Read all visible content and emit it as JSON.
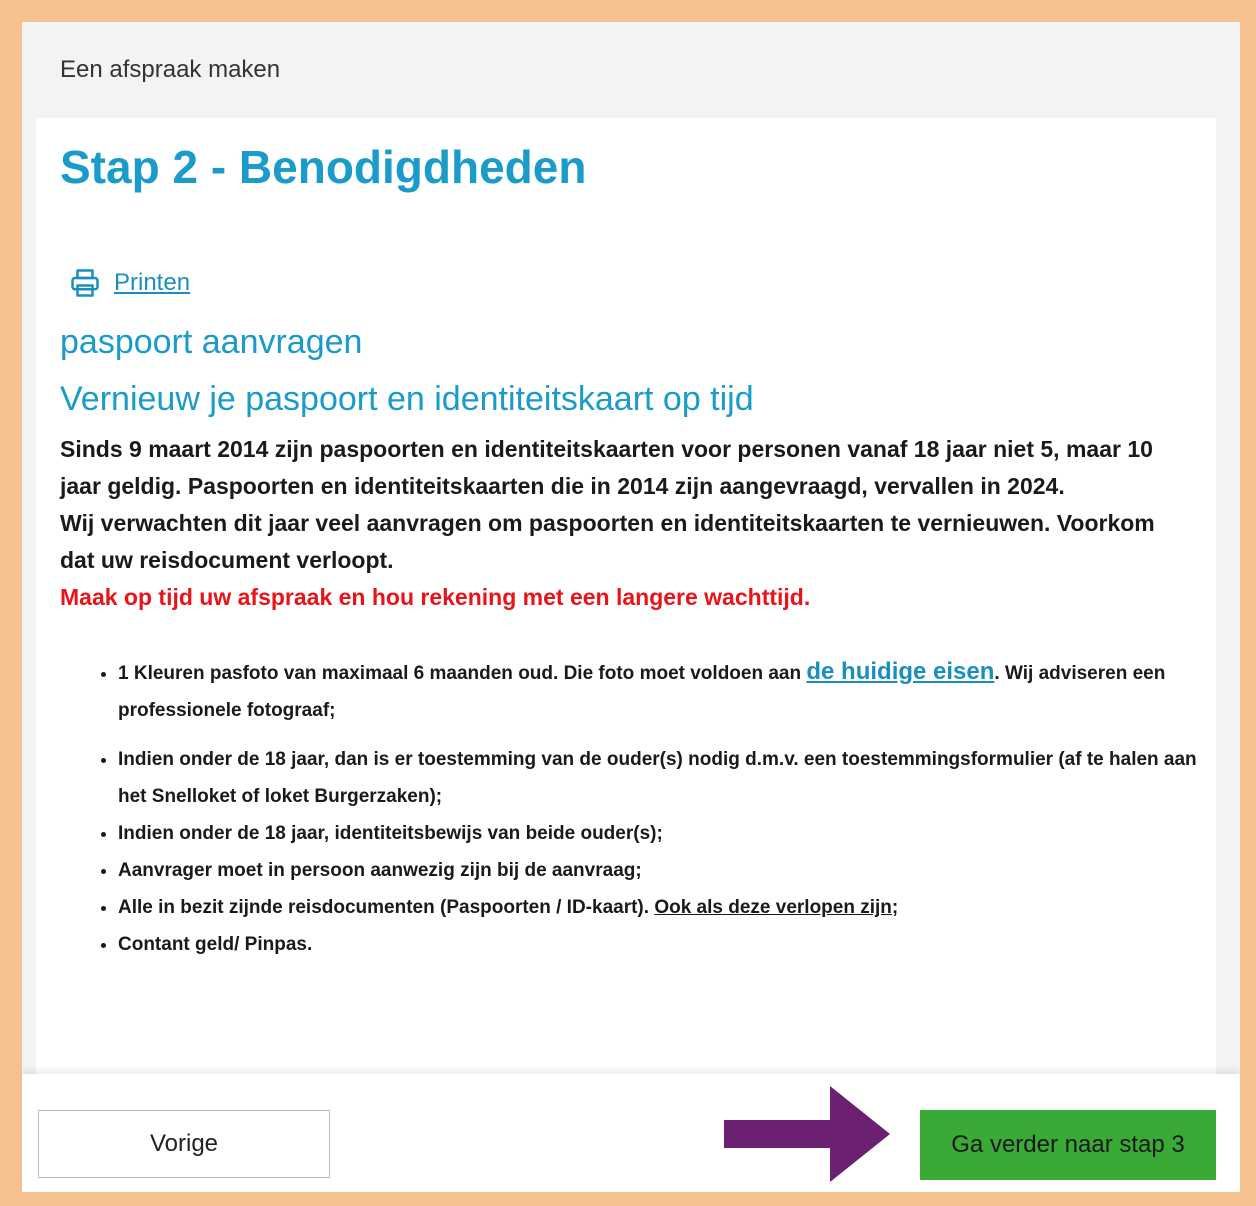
{
  "window": {
    "title": "Een afspraak maken"
  },
  "step": {
    "title": "Stap 2 - Benodigdheden"
  },
  "print": {
    "label": "Printen",
    "icon": "printer-icon"
  },
  "product": {
    "title": "paspoort aanvragen"
  },
  "notice": {
    "heading": "Vernieuw je paspoort en identiteitskaart op tijd",
    "paragraph1": "Sinds 9 maart 2014 zijn paspoorten en identiteitskaarten voor personen vanaf 18 jaar niet 5, maar 10 jaar geldig. Paspoorten en identiteitskaarten die in 2014 zijn aangevraagd, vervallen in 2024.",
    "paragraph2": "Wij verwachten dit jaar veel aanvragen om paspoorten en identiteitskaarten te vernieuwen. Voorkom dat uw reisdocument verloopt.",
    "warning": "Maak op tijd uw afspraak en hou rekening met een langere wachttijd.",
    "warning_color": "#e8141a"
  },
  "requirements": {
    "item1_before": "1 Kleuren pasfoto van maximaal 6 maanden oud. Die foto moet voldoen aan ",
    "item1_link": "de huidige eisen",
    "item1_after": ". Wij adviseren een professionele fotograaf;",
    "item2": "Indien onder de 18 jaar, dan is er toestemming van de ouder(s) nodig d.m.v. een toestemmingsformulier (af te halen aan het Snelloket of loket Burgerzaken);",
    "item3": "Indien onder de 18 jaar, identiteitsbewijs van beide ouder(s);",
    "item4": "Aanvrager moet in persoon aanwezig zijn bij de aanvraag;",
    "item5_before": "Alle in bezit zijnde reisdocumenten (Paspoorten / ID-kaart). ",
    "item5_underline": "Ook als deze verlopen zijn",
    "item5_after": ";",
    "item6": "Contant geld/ Pinpas."
  },
  "footer": {
    "prev_label": "Vorige",
    "next_label": "Ga verder naar stap 3",
    "next_color": "#3aa935",
    "arrow_color": "#6b2070"
  },
  "colors": {
    "accent": "#1a9bc9",
    "border": "#f5c28f"
  }
}
